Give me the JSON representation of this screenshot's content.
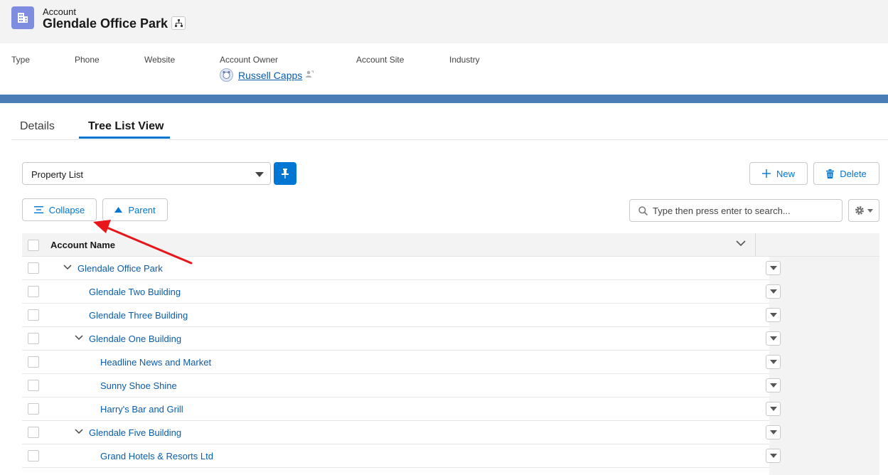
{
  "record": {
    "object_label": "Account",
    "title": "Glendale Office Park"
  },
  "highlights": {
    "type_label": "Type",
    "phone_label": "Phone",
    "website_label": "Website",
    "owner_label": "Account Owner",
    "owner_name": "Russell Capps",
    "site_label": "Account Site",
    "industry_label": "Industry"
  },
  "tabs": [
    {
      "label": "Details",
      "active": false
    },
    {
      "label": "Tree List View",
      "active": true
    }
  ],
  "toolbar": {
    "list_select_value": "Property List",
    "new_label": "New",
    "delete_label": "Delete",
    "collapse_label": "Collapse",
    "parent_label": "Parent",
    "search_placeholder": "Type then press enter to search..."
  },
  "grid": {
    "column_header": "Account Name",
    "rows": [
      {
        "name": "Glendale Office Park",
        "level": 0,
        "expanded": true
      },
      {
        "name": "Glendale Two Building",
        "level": 1,
        "expanded": false
      },
      {
        "name": "Glendale Three Building",
        "level": 1,
        "expanded": false
      },
      {
        "name": "Glendale One Building",
        "level": 1,
        "expanded": true
      },
      {
        "name": "Headline News and Market",
        "level": 2,
        "expanded": false
      },
      {
        "name": "Sunny Shoe Shine",
        "level": 2,
        "expanded": false
      },
      {
        "name": "Harry's Bar and Grill",
        "level": 2,
        "expanded": false
      },
      {
        "name": "Glendale Five Building",
        "level": 1,
        "expanded": true
      },
      {
        "name": "Grand Hotels & Resorts Ltd",
        "level": 2,
        "expanded": false
      }
    ]
  },
  "annotation": {
    "arrow_color": "#e8161b"
  },
  "icons": {
    "record": "building-icon",
    "hierarchy": "hierarchy-icon",
    "pin": "pin-icon",
    "new": "plus-icon",
    "delete": "trash-icon",
    "collapse": "collapse-icon",
    "parent": "triangle-up-icon",
    "search": "search-icon",
    "settings": "gear-icon"
  },
  "colors": {
    "brand": "#0176d3",
    "link": "#0b5cab",
    "record_icon": "#7f8de1"
  }
}
